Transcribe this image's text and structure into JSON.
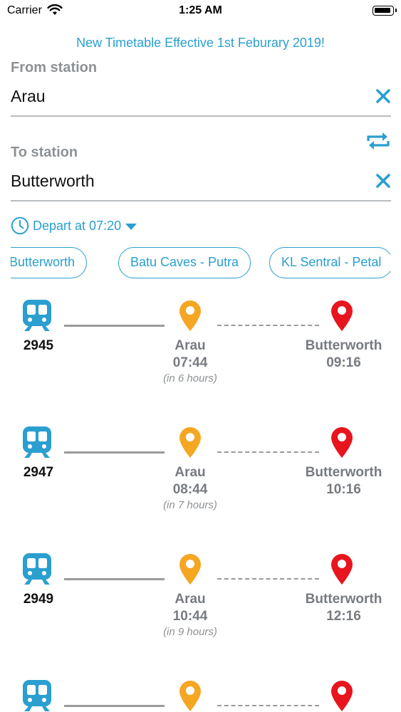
{
  "status_bar": {
    "carrier": "Carrier",
    "time": "1:25 AM"
  },
  "banner": "New Timetable Effective 1st Feburary 2019!",
  "from": {
    "label": "From station",
    "value": "Arau"
  },
  "to": {
    "label": "To station",
    "value": "Butterworth"
  },
  "depart": {
    "label": "Depart at 07:20"
  },
  "chips": [
    "- Butterworth",
    "Batu Caves - Putra",
    "KL Sentral - Petal"
  ],
  "colors": {
    "accent": "#2a9fd0",
    "origin_pin": "#f5a623",
    "dest_pin": "#e8141e",
    "train": "#2a9fd0"
  },
  "trips": [
    {
      "train": "2945",
      "from_name": "Arau",
      "from_time": "07:44",
      "eta": "(in 6 hours)",
      "to_name": "Butterworth",
      "to_time": "09:16"
    },
    {
      "train": "2947",
      "from_name": "Arau",
      "from_time": "08:44",
      "eta": "(in 7 hours)",
      "to_name": "Butterworth",
      "to_time": "10:16"
    },
    {
      "train": "2949",
      "from_name": "Arau",
      "from_time": "10:44",
      "eta": "(in 9 hours)",
      "to_name": "Butterworth",
      "to_time": "12:16"
    },
    {
      "train": "",
      "from_name": "",
      "from_time": "",
      "eta": "",
      "to_name": "",
      "to_time": ""
    }
  ]
}
